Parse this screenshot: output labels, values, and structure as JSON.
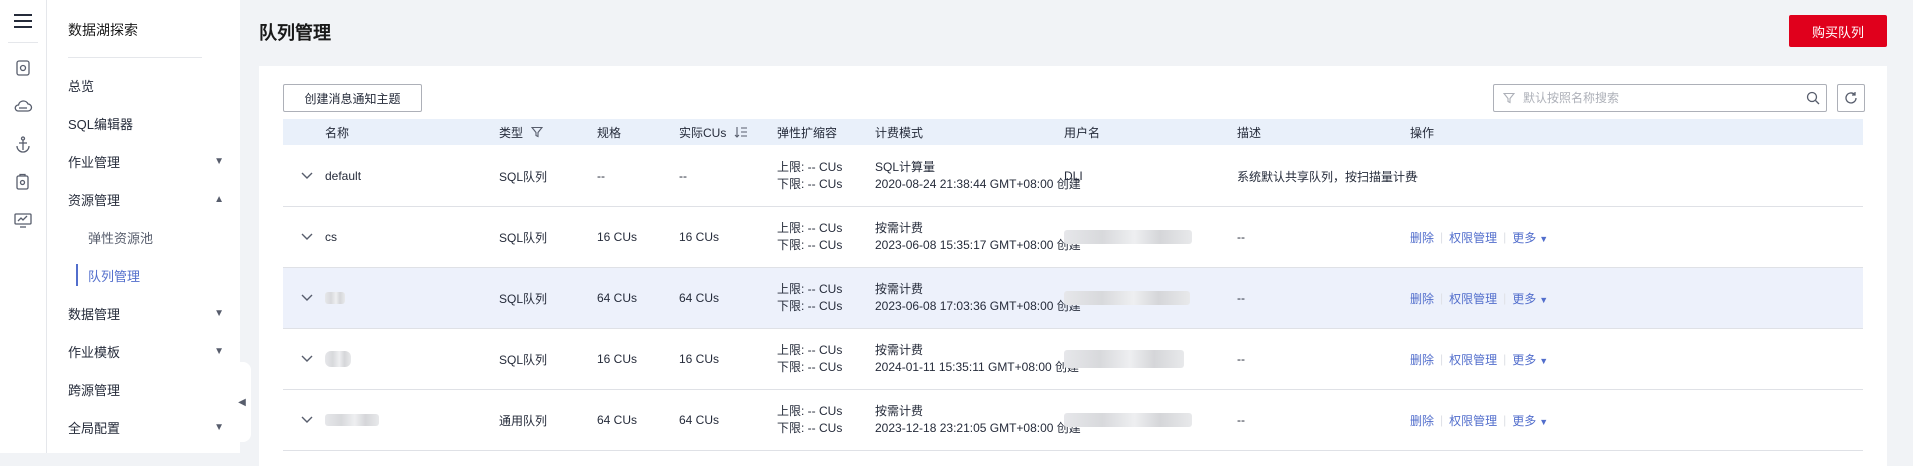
{
  "sidebar": {
    "title": "数据湖探索",
    "items": [
      {
        "label": "总览"
      },
      {
        "label": "SQL编辑器"
      },
      {
        "label": "作业管理",
        "arrow": "▼"
      },
      {
        "label": "资源管理",
        "arrow": "▲"
      },
      {
        "label": "弹性资源池"
      },
      {
        "label": "队列管理"
      },
      {
        "label": "数据管理",
        "arrow": "▼"
      },
      {
        "label": "作业模板",
        "arrow": "▼"
      },
      {
        "label": "跨源管理"
      },
      {
        "label": "全局配置",
        "arrow": "▼"
      }
    ],
    "rail_icons": [
      "menu-icon",
      "database-icon",
      "cloud-icon",
      "anchor-icon",
      "job-icon",
      "monitor-icon"
    ]
  },
  "header": {
    "title": "队列管理",
    "buy_label": "购买队列"
  },
  "toolbar": {
    "create_label": "创建消息通知主题",
    "search_placeholder": "默认按照名称搜索"
  },
  "table": {
    "columns": [
      "名称",
      "类型",
      "规格",
      "实际CUs",
      "弹性扩缩容",
      "计费模式",
      "用户名",
      "描述",
      "操作"
    ],
    "rows": [
      {
        "name": "default",
        "type": "SQL队列",
        "spec": "--",
        "actual": "--",
        "elastic_upper": "上限: -- CUs",
        "elastic_lower": "下限: -- CUs",
        "billing": "SQL计算量",
        "billing_time": "2020-08-24 21:38:44 GMT+08:00 创建",
        "user": "DLI",
        "desc": "系统默认共享队列，按扫描量计费",
        "ops": "--"
      },
      {
        "name": "cs",
        "type": "SQL队列",
        "spec": "16 CUs",
        "actual": "16 CUs",
        "elastic_upper": "上限: -- CUs",
        "elastic_lower": "下限: -- CUs",
        "billing": "按需计费",
        "billing_time": "2023-06-08 15:35:17 GMT+08:00 创建",
        "user": "",
        "desc": "--",
        "op_delete": "删除",
        "op_perm": "权限管理",
        "op_more": "更多"
      },
      {
        "name": "",
        "type": "SQL队列",
        "spec": "64 CUs",
        "actual": "64 CUs",
        "elastic_upper": "上限: -- CUs",
        "elastic_lower": "下限: -- CUs",
        "billing": "按需计费",
        "billing_time": "2023-06-08 17:03:36 GMT+08:00 创建",
        "user": "",
        "desc": "--",
        "op_delete": "删除",
        "op_perm": "权限管理",
        "op_more": "更多"
      },
      {
        "name": "",
        "type": "SQL队列",
        "spec": "16 CUs",
        "actual": "16 CUs",
        "elastic_upper": "上限: -- CUs",
        "elastic_lower": "下限: -- CUs",
        "billing": "按需计费",
        "billing_time": "2024-01-11 15:35:11 GMT+08:00 创建",
        "user": "",
        "desc": "--",
        "op_delete": "删除",
        "op_perm": "权限管理",
        "op_more": "更多"
      },
      {
        "name": "",
        "type": "通用队列",
        "spec": "64 CUs",
        "actual": "64 CUs",
        "elastic_upper": "上限: -- CUs",
        "elastic_lower": "下限: -- CUs",
        "billing": "按需计费",
        "billing_time": "2023-12-18 23:21:05 GMT+08:00 创建",
        "user": "",
        "desc": "--",
        "op_delete": "删除",
        "op_perm": "权限管理",
        "op_more": "更多"
      }
    ]
  },
  "colors": {
    "primary": "#526ecc",
    "buy": "#e0001c",
    "header_bg": "#e9f0fa",
    "row_highlight": "#edf1fb"
  }
}
